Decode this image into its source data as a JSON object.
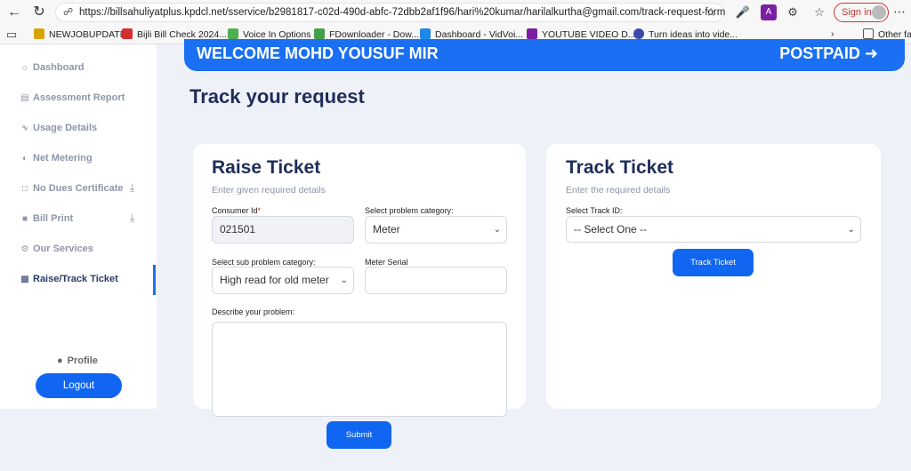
{
  "browser": {
    "url": "https://billsahuliyatplus.kpdcl.net/sservice/b2981817-c02d-490d-abfc-72dbb2af1f96/hari%20kumar/harilalkurtha@gmail.com/track-request-form",
    "sign_in": "Sign in",
    "bookmarks": [
      {
        "label": "NEWJOBUPDATE",
        "color": "#d8a300"
      },
      {
        "label": "Bijli Bill Check 2024...",
        "color": "#d32f2f"
      },
      {
        "label": "Voice In Options",
        "color": "#4caf50"
      },
      {
        "label": "FDownloader - Dow...",
        "color": "#43a047"
      },
      {
        "label": "Dashboard - VidVoi...",
        "color": "#1e88e5"
      },
      {
        "label": "YOUTUBE VIDEO D...",
        "color": "#7b1fa2"
      },
      {
        "label": "Turn ideas into vide...",
        "color": "#3949ab"
      }
    ],
    "other_favorites": "Other fav"
  },
  "sidebar": {
    "items": [
      {
        "label": "Dashboard",
        "icon": "home-icon"
      },
      {
        "label": "Assessment Report",
        "icon": "report-icon"
      },
      {
        "label": "Usage Details",
        "icon": "chart-icon"
      },
      {
        "label": "Net Metering",
        "icon": "meter-icon"
      },
      {
        "label": "No Dues Certificate",
        "icon": "file-icon"
      },
      {
        "label": "Bill Print",
        "icon": "file-icon"
      },
      {
        "label": "Our Services",
        "icon": "gears-icon"
      },
      {
        "label": "Raise/Track Ticket",
        "icon": "ticket-icon"
      }
    ],
    "profile": "Profile",
    "logout": "Logout"
  },
  "banner": {
    "welcome": "WELCOME MOHD YOUSUF MIR",
    "plan": "POSTPAID"
  },
  "page_title": "Track your request",
  "raise": {
    "title": "Raise Ticket",
    "subtitle": "Enter given required details",
    "consumer_id_label": "Consumer Id",
    "consumer_id_value": "021501",
    "category_label": "Select problem category:",
    "category_value": "Meter",
    "sub_category_label": "Select sub problem category:",
    "sub_category_value": "High read for old meter",
    "meter_serial_label": "Meter Serial",
    "meter_serial_value": "",
    "describe_label": "Describe your problem:",
    "submit": "Submit"
  },
  "track": {
    "title": "Track Ticket",
    "subtitle": "Enter the required details",
    "track_id_label": "Select Track ID:",
    "track_id_value": "-- Select One --",
    "button": "Track Ticket"
  },
  "colors": {
    "accent": "#1066f0",
    "title": "#1f2d59",
    "page_bg": "#eef2f8"
  }
}
